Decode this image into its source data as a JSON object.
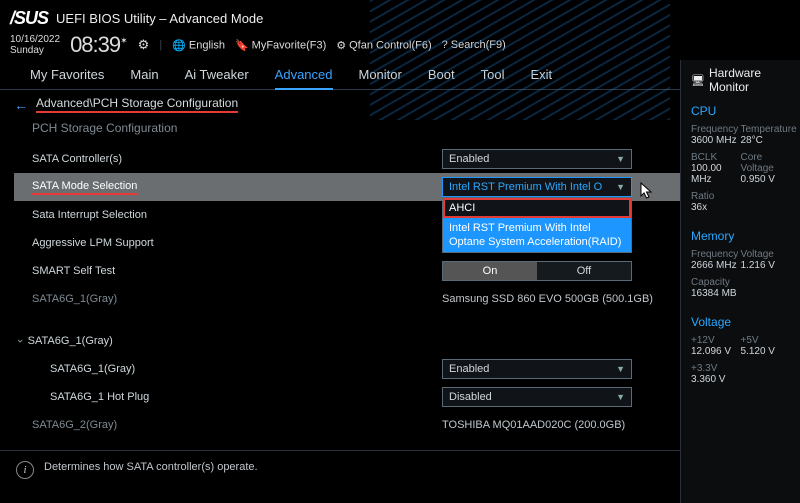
{
  "brand": "/SUS",
  "title": "UEFI BIOS Utility – Advanced Mode",
  "date": "10/16/2022",
  "day": "Sunday",
  "time": "08:39",
  "toolbar": {
    "lang": "English",
    "fav": "MyFavorite(F3)",
    "fan": "Qfan Control(F6)",
    "search": "Search(F9)"
  },
  "tabs": [
    "My Favorites",
    "Main",
    "Ai Tweaker",
    "Advanced",
    "Monitor",
    "Boot",
    "Tool",
    "Exit"
  ],
  "active_tab": "Advanced",
  "breadcrumb": "Advanced\\PCH Storage Configuration",
  "section_heading": "PCH Storage Configuration",
  "rows": {
    "sata_ctrl": {
      "label": "SATA Controller(s)",
      "value": "Enabled"
    },
    "sata_mode": {
      "label": "SATA Mode Selection",
      "value": "Intel RST Premium With Intel O"
    },
    "sata_int": {
      "label": "Sata Interrupt Selection"
    },
    "lpm": {
      "label": "Aggressive LPM Support"
    },
    "smart": {
      "label": "SMART Self Test",
      "on": "On",
      "off": "Off"
    },
    "port0": {
      "label": "SATA6G_1(Gray)",
      "info": "Samsung SSD 860 EVO 500GB (500.1GB)"
    },
    "port1": {
      "label": "SATA6G_1(Gray)"
    },
    "sub1": {
      "label": "SATA6G_1(Gray)",
      "value": "Enabled"
    },
    "sub1hot": {
      "label": "SATA6G_1 Hot Plug",
      "value": "Disabled"
    },
    "port2": {
      "label": "SATA6G_2(Gray)",
      "info": "TOSHIBA MQ01AAD020C (200.0GB)"
    }
  },
  "dropdown_options": {
    "ahci": "AHCI",
    "rst": "Intel RST Premium With Intel Optane System Acceleration(RAID)"
  },
  "help_text": "Determines how SATA controller(s) operate.",
  "hw": {
    "head": "Hardware Monitor",
    "cpu": "CPU",
    "cpu_rows": [
      {
        "k1": "Frequency",
        "v1": "3600 MHz",
        "k2": "Temperature",
        "v2": "28°C"
      },
      {
        "k1": "BCLK",
        "v1": "100.00 MHz",
        "k2": "Core Voltage",
        "v2": "0.950 V"
      },
      {
        "k1": "Ratio",
        "v1": "36x",
        "k2": "",
        "v2": ""
      }
    ],
    "mem": "Memory",
    "mem_rows": [
      {
        "k1": "Frequency",
        "v1": "2666 MHz",
        "k2": "Voltage",
        "v2": "1.216 V"
      },
      {
        "k1": "Capacity",
        "v1": "16384 MB",
        "k2": "",
        "v2": ""
      }
    ],
    "volt": "Voltage",
    "volt_rows": [
      {
        "k1": "+12V",
        "v1": "12.096 V",
        "k2": "+5V",
        "v2": "5.120 V"
      },
      {
        "k1": "+3.3V",
        "v1": "3.360 V",
        "k2": "",
        "v2": ""
      }
    ]
  }
}
